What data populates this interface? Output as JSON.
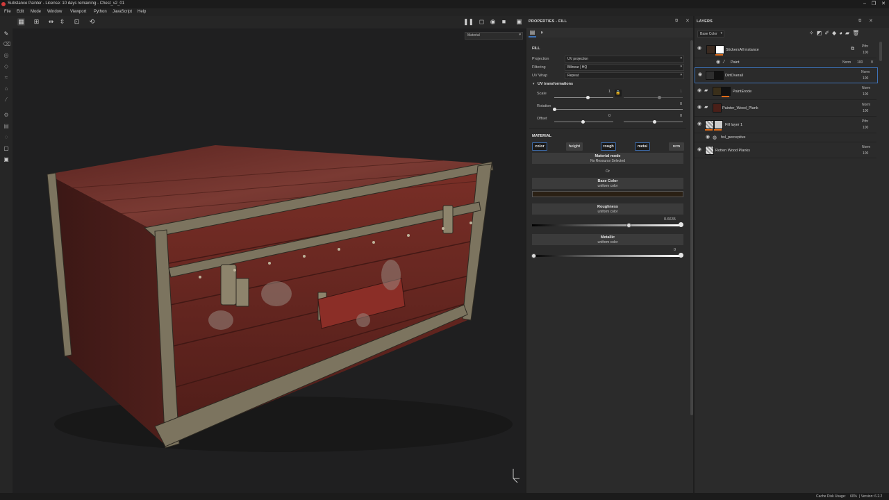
{
  "window": {
    "title": "Substance Painter - License: 10 days remaining - Chest_v2_01"
  },
  "menu": [
    "File",
    "Edit",
    "Mode",
    "Window",
    "Viewport",
    "Python",
    "JavaScript",
    "Help"
  ],
  "viewport": {
    "mode_select": "Material"
  },
  "properties": {
    "header": "PROPERTIES - FILL",
    "section_fill": "FILL",
    "projection_label": "Projection",
    "projection_value": "UV projection",
    "filtering_label": "Filtering",
    "filtering_value": "Bilinear | HQ",
    "uvwrap_label": "UV Wrap",
    "uvwrap_value": "Repeat",
    "uvtrans_title": "UV transformations",
    "scale_label": "Scale",
    "scale_value": "1",
    "scale_value2": "1",
    "rotation_label": "Rotation",
    "rotation_value": "0",
    "offset_label": "Offset",
    "offset_value1": "0",
    "offset_value2": "0",
    "section_material": "MATERIAL",
    "channels": [
      {
        "label": "color",
        "enabled": true
      },
      {
        "label": "height",
        "enabled": false
      },
      {
        "label": "rough",
        "enabled": true
      },
      {
        "label": "metal",
        "enabled": true
      },
      {
        "label": "nrm",
        "enabled": false
      }
    ],
    "material_mode_title": "Material mode",
    "material_mode_sub": "No Resource Selected",
    "or_text": "Or",
    "base_color_title": "Base Color",
    "base_color_sub": "uniform color",
    "base_color_swatch": "#2a2014",
    "roughness_title": "Roughness",
    "roughness_sub": "uniform color",
    "roughness_value": "0.6635",
    "metallic_title": "Metallic",
    "metallic_sub": "uniform color",
    "metallic_value": "0"
  },
  "layers": {
    "header": "LAYERS",
    "channel_select": "Base Color",
    "items": [
      {
        "name": "StickersAll instance",
        "blend": "Pthr",
        "opacity": "100"
      },
      {
        "name": "Paint",
        "blend": "Norm",
        "opacity": "100"
      },
      {
        "name": "DirtOverall",
        "blend": "Norm",
        "opacity": "100"
      },
      {
        "name": "PaintErode",
        "blend": "Norm",
        "opacity": "100"
      },
      {
        "name": "Painter_Wood_Plank",
        "blend": "Norm",
        "opacity": "100"
      },
      {
        "name": "Fill layer 1",
        "blend": "Pthr",
        "opacity": "100"
      },
      {
        "name": "hsl_perceptive",
        "blend": "",
        "opacity": ""
      },
      {
        "name": "Rotten Wood Planks",
        "blend": "Norm",
        "opacity": "100"
      }
    ]
  },
  "status": {
    "cache_label": "Cache Disk Usage:",
    "cache_value": "60%",
    "version": "| Version: 6.2.2"
  },
  "colors": {
    "accent": "#3e73b8",
    "orange": "#e06a16",
    "chest_wood": "#6b2a22",
    "chest_metal": "#8a7f66"
  }
}
